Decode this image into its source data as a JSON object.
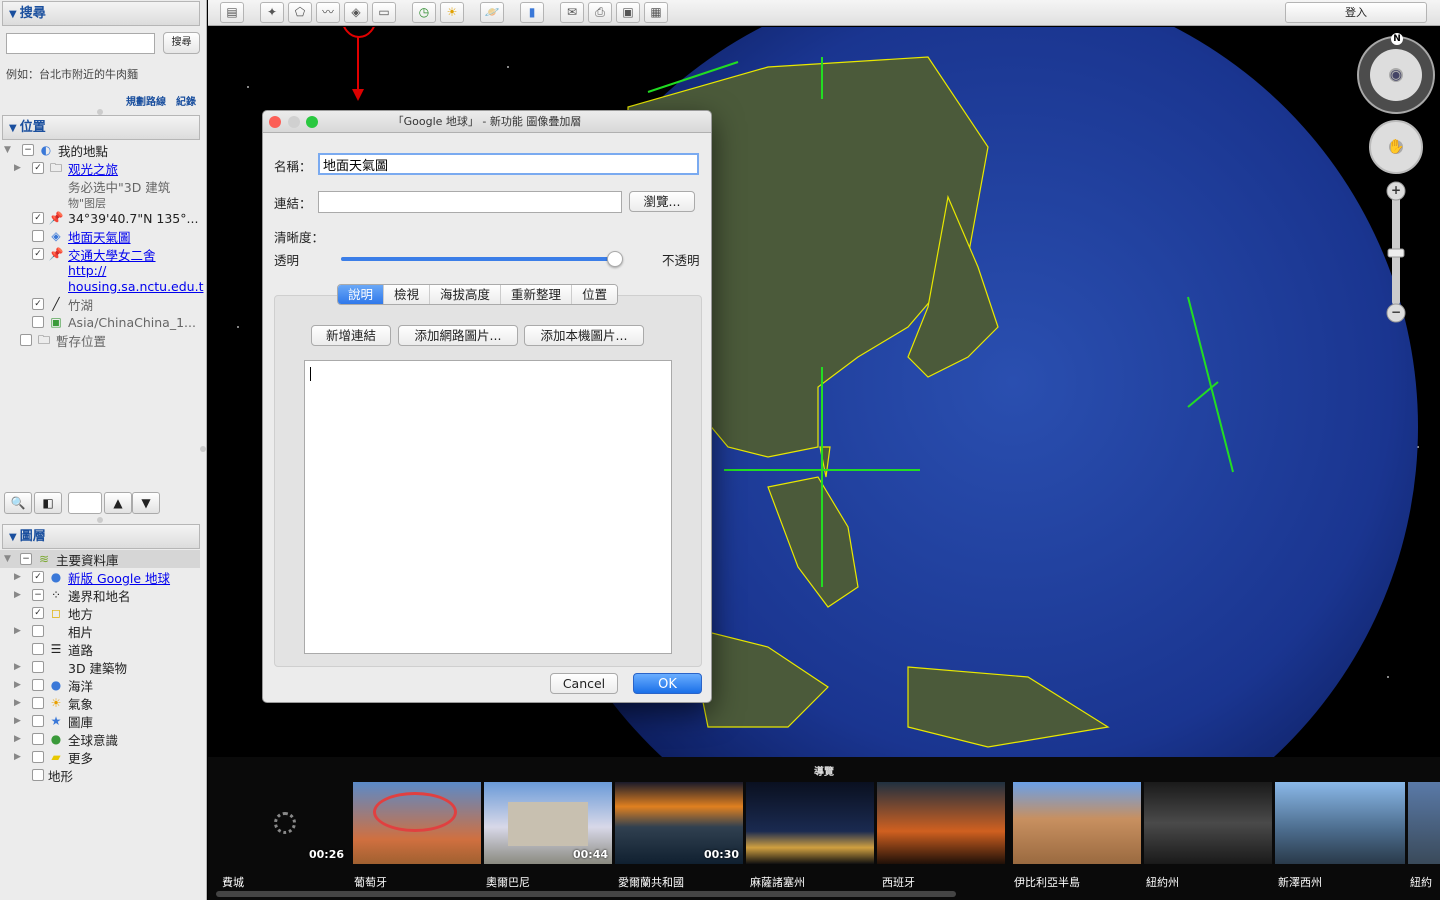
{
  "sidebar": {
    "search": {
      "header": "搜尋",
      "button": "搜尋",
      "input_value": "",
      "hint": "例如：台北市附近的牛肉麵",
      "route_link": "規劃路線",
      "history_link": "紀錄"
    },
    "places": {
      "header": "位置",
      "items": [
        {
          "label": "我的地點",
          "link": false
        },
        {
          "label": "观光之旅",
          "link": true
        },
        {
          "label": "务必选中\"3D 建筑",
          "link": false
        },
        {
          "label": "物\"图层",
          "link": false
        },
        {
          "label": "34°39'40.7\"N 135°...",
          "link": false
        },
        {
          "label": "地面天氣圖",
          "link": true
        },
        {
          "label": "交通大學女二舍",
          "link": true
        },
        {
          "label": "http://",
          "link": true
        },
        {
          "label": "housing.sa.nctu.edu.t",
          "link": true
        },
        {
          "label": "竹湖",
          "link": false
        },
        {
          "label": "Asia/ChinaChina_1...",
          "link": false
        },
        {
          "label": "暫存位置",
          "link": false
        }
      ]
    },
    "layers": {
      "header": "圖層",
      "items": [
        {
          "label": "主要資料庫",
          "link": false
        },
        {
          "label": "新版 Google 地球",
          "link": true
        },
        {
          "label": "邊界和地名",
          "link": false
        },
        {
          "label": "地方",
          "link": false
        },
        {
          "label": "相片",
          "link": false
        },
        {
          "label": "道路",
          "link": false
        },
        {
          "label": "3D 建築物",
          "link": false
        },
        {
          "label": "海洋",
          "link": false
        },
        {
          "label": "氣象",
          "link": false
        },
        {
          "label": "圖庫",
          "link": false
        },
        {
          "label": "全球意識",
          "link": false
        },
        {
          "label": "更多",
          "link": false
        },
        {
          "label": "地形",
          "link": false
        }
      ]
    }
  },
  "toolbar": {
    "signin_label": "登入"
  },
  "dialog": {
    "title": "「Google 地球」 - 新功能 圖像疊加層",
    "name_label": "名稱：",
    "name_value": "地面天氣圖",
    "link_label": "連結：",
    "link_value": "",
    "browse_label": "瀏覽...",
    "opacity_label": "清晰度：",
    "transparent_label": "透明",
    "opaque_label": "不透明",
    "opacity_value": 1.0,
    "tabs": [
      "說明",
      "檢視",
      "海拔高度",
      "重新整理",
      "位置"
    ],
    "active_tab": "說明",
    "add_link_label": "新增連結",
    "add_web_image_label": "添加網路圖片...",
    "add_local_image_label": "添加本機圖片...",
    "description_value": "",
    "cancel_label": "Cancel",
    "ok_label": "OK"
  },
  "tour": {
    "title": "導覽",
    "items": [
      {
        "duration": "00:26",
        "label": "費城"
      },
      {
        "duration": "",
        "label": "葡萄牙"
      },
      {
        "duration": "00:44",
        "label": "奧爾巴尼"
      },
      {
        "duration": "00:30",
        "label": "愛爾蘭共和國"
      },
      {
        "duration": "",
        "label": "麻薩諸塞州"
      },
      {
        "duration": "",
        "label": "西班牙"
      },
      {
        "duration": "",
        "label": "伊比利亞半島"
      },
      {
        "duration": "",
        "label": "紐約州"
      },
      {
        "duration": "",
        "label": "新澤西州"
      },
      {
        "duration": "",
        "label": "紐約"
      }
    ]
  },
  "navigation": {
    "north_label": "N",
    "zoom_in": "+",
    "zoom_out": "−"
  },
  "colors": {
    "accent": "#2f78ea",
    "border_lines": "#e8e800",
    "grid_lines": "#22dd22",
    "annotation": "#e00000"
  }
}
